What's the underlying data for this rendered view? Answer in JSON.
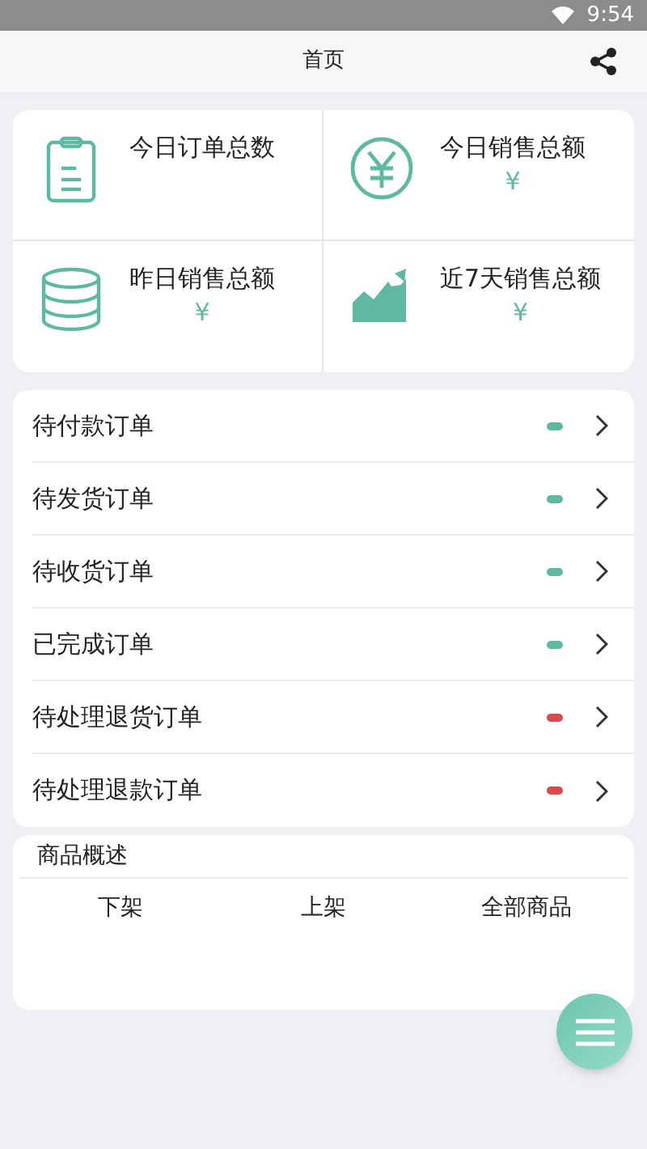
{
  "status_bar": {
    "time": "9:54"
  },
  "header": {
    "title": "首页"
  },
  "stats": [
    {
      "kind": "clipboard",
      "label": "今日订单总数"
    },
    {
      "kind": "yen",
      "label": "今日销售总额",
      "value": "¥"
    },
    {
      "kind": "database",
      "label": "昨日销售总额",
      "value": "¥"
    },
    {
      "kind": "trend",
      "label": "近7天销售总额",
      "value": "¥"
    }
  ],
  "orders": [
    {
      "label": "待付款订单",
      "color": "#5fb8a2"
    },
    {
      "label": "待发货订单",
      "color": "#5fb8a2"
    },
    {
      "label": "待收货订单",
      "color": "#5fb8a2"
    },
    {
      "label": "已完成订单",
      "color": "#5fb8a2"
    },
    {
      "label": "待处理退货订单",
      "color": "#d94a4a"
    },
    {
      "label": "待处理退款订单",
      "color": "#d94a4a"
    }
  ],
  "products": {
    "title": "商品概述",
    "columns": [
      "下架",
      "上架",
      "全部商品"
    ]
  }
}
